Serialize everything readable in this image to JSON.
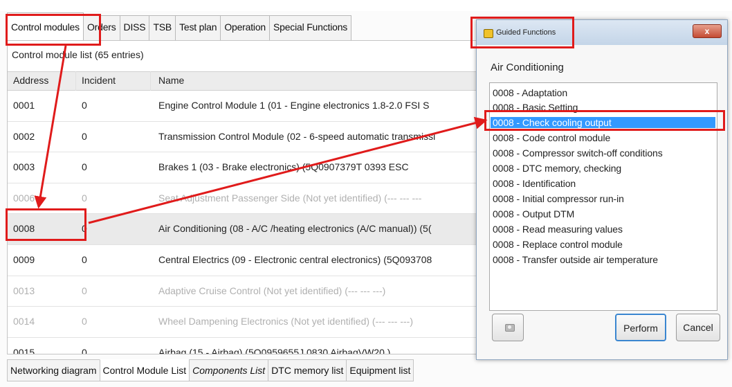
{
  "tabs": [
    "Control modules",
    "Orders",
    "DISS",
    "TSB",
    "Test plan",
    "Operation",
    "Special Functions"
  ],
  "list_caption": "Control module list (65 entries)",
  "columns": [
    "Address",
    "Incident",
    "Name"
  ],
  "rows": [
    {
      "address": "0001",
      "incident": "0",
      "name": "Engine Control Module 1 (01 - Engine electronics 1.8-2.0 FSI S"
    },
    {
      "address": "0002",
      "incident": "0",
      "name": "Transmission Control Module (02 - 6-speed automatic transmissi"
    },
    {
      "address": "0003",
      "incident": "0",
      "name": "Brakes 1 (03 - Brake electronics) (5Q0907379T   0393   ESC"
    },
    {
      "address": "0006",
      "incident": "0",
      "name": "Seat Adjustment Passenger Side (Not yet identified) (---   ---   ---"
    },
    {
      "address": "0008",
      "incident": "0",
      "name": "Air Conditioning (08 - A/C /heating electronics (A/C manual)) (5("
    },
    {
      "address": "0009",
      "incident": "0",
      "name": "Central Electrics (09 - Electronic central electronics) (5Q093708"
    },
    {
      "address": "0013",
      "incident": "0",
      "name": "Adaptive Cruise Control (Not yet identified) (---   ---   ---)"
    },
    {
      "address": "0014",
      "incident": "0",
      "name": "Wheel Dampening Electronics (Not yet identified) (---   ---   ---)"
    },
    {
      "address": "0015",
      "incident": "0",
      "name": "Airbag (15 - Airbag) (5Q0959655J     0830   AirbagVW20  )"
    }
  ],
  "bottom_tabs": [
    "Networking diagram",
    "Control Module List",
    "Components List",
    "DTC memory list",
    "Equipment list"
  ],
  "dialog": {
    "title": "Guided Functions",
    "close": "x",
    "section": "Air Conditioning",
    "items": [
      "0008 - Adaptation",
      "0008 - Basic Setting",
      "0008 - Check cooling output",
      "0008 - Code control module",
      "0008 - Compressor switch-off conditions",
      "0008 - DTC memory, checking",
      "0008 - Identification",
      "0008 - Initial compressor run-in",
      "0008 - Output DTM",
      "0008 - Read measuring values",
      "0008 - Replace control module",
      "0008 - Transfer outside air temperature"
    ],
    "perform": "Perform",
    "cancel": "Cancel"
  },
  "colors": {
    "annotation_red": "#e01b1b",
    "selection_blue": "#3399ff",
    "title_gradient": "#c4d5e8"
  }
}
